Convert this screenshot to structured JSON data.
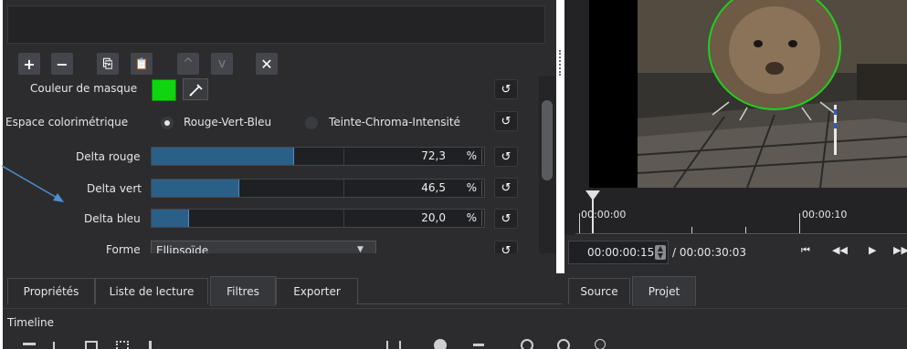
{
  "toolbar": {
    "add": "+",
    "remove": "−",
    "copy": "⎘",
    "paste": "📋",
    "up": "^",
    "down": "v",
    "close": "✕"
  },
  "filter_params": {
    "mask_color_label": "Couleur de masque",
    "mask_color": "#11d411",
    "colorspace_label": "Espace colorimétrique",
    "colorspace_options": [
      "Rouge-Vert-Bleu",
      "Teinte-Chroma-Intensité"
    ],
    "delta_rows": [
      {
        "label": "Delta rouge",
        "value": "72,3",
        "unit": "%",
        "fraction": 0.425
      },
      {
        "label": "Delta vert",
        "value": "46,5",
        "unit": "%",
        "fraction": 0.26
      },
      {
        "label": "Delta bleu",
        "value": "20,0",
        "unit": "%",
        "fraction": 0.11
      }
    ],
    "shape_label": "Forme",
    "shape_value": "Ellipsoïde"
  },
  "timeline_ruler": {
    "tick_start": "00:00:00",
    "tick_10": "00:00:10"
  },
  "transport": {
    "current_time": "00:00:00:15",
    "total_time": "/ 00:00:30:03"
  },
  "tabs_left": [
    "Propriétés",
    "Liste de lecture",
    "Filtres",
    "Exporter"
  ],
  "tabs_right": [
    "Source",
    "Projet"
  ],
  "timeline_label": "Timeline",
  "colors": {
    "panel": "#2c2c2f",
    "accent_fill": "#2a5f88",
    "arrow": "#4d8fcf"
  }
}
